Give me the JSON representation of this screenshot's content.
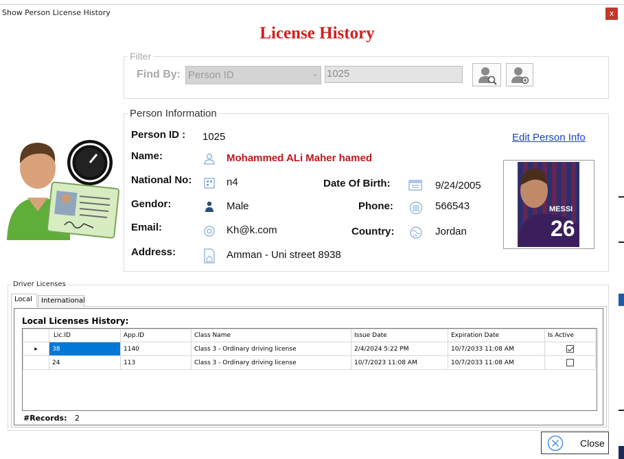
{
  "window": {
    "title": "Show Person License History",
    "close_glyph": "x"
  },
  "header": {
    "title": "License History"
  },
  "filter": {
    "legend": "Filter",
    "find_by_label": "Find By:",
    "find_by_value": "Person ID",
    "search_value": "1025",
    "find_icon": "person-search-icon",
    "add_icon": "person-add-icon"
  },
  "person": {
    "legend": "Person Information",
    "person_id_label": "Person ID :",
    "person_id": "1025",
    "edit_link": "Edit Person Info",
    "name_label": "Name:",
    "name": "Mohammed ALi Maher hamed",
    "national_no_label": "National No:",
    "national_no": "n4",
    "dob_label": "Date Of Birth:",
    "dob": "9/24/2005",
    "gender_label": "Gendor:",
    "gender": "Male",
    "phone_label": "Phone:",
    "phone": "566543",
    "email_label": "Email:",
    "email": "Kh@k.com",
    "country_label": "Country:",
    "country": "Jordan",
    "address_label": "Address:",
    "address": "Amman - Uni street 8938",
    "photo_jersey_text": "MESSI",
    "photo_jersey_number": "26"
  },
  "licenses": {
    "legend": "Driver Licenses",
    "tabs": [
      "Local",
      "International"
    ],
    "local_title": "Local Licenses History:",
    "columns": [
      "Lic.ID",
      "App.ID",
      "Class Name",
      "Issue Date",
      "Expiration Date",
      "Is Active"
    ],
    "rows": [
      {
        "lic_id": "38",
        "app_id": "1140",
        "class_name": "Class 3 - Ordinary driving license",
        "issue_date": "2/4/2024 5:22 PM",
        "expiration_date": "10/7/2033 11:08 AM",
        "is_active": true,
        "selected": true
      },
      {
        "lic_id": "24",
        "app_id": "113",
        "class_name": "Class 3 - Ordinary driving license",
        "issue_date": "10/7/2023 11:08 AM",
        "expiration_date": "10/7/2033 11:08 AM",
        "is_active": false,
        "selected": false
      }
    ],
    "records_label": "#Records:",
    "records_count": "2"
  },
  "footer": {
    "close_label": "Close"
  },
  "colors": {
    "title_red": "#d21f1f",
    "name_red": "#c0161c",
    "link_blue": "#1b3fcf",
    "selection_blue": "#0078d7"
  }
}
